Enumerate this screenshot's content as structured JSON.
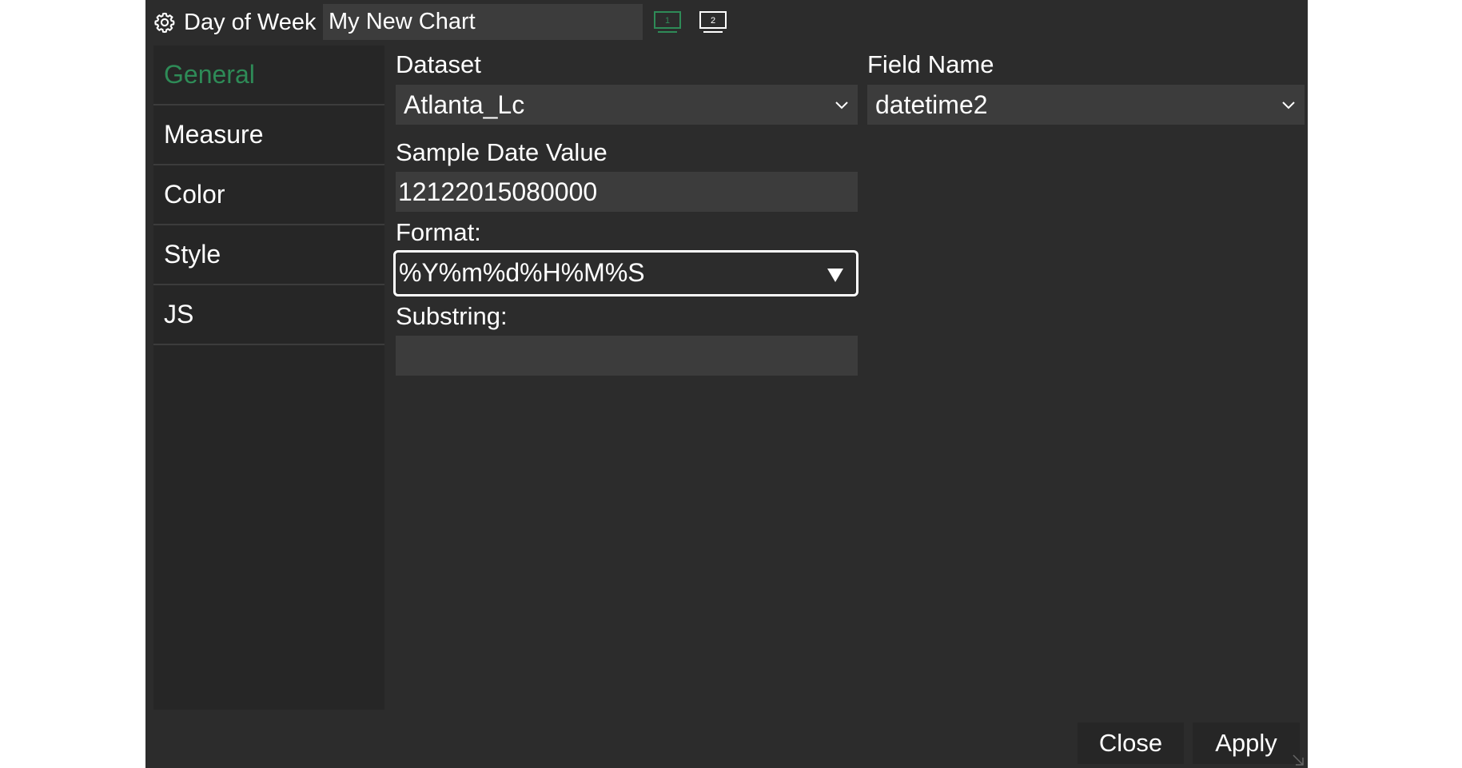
{
  "titlebar": {
    "icon": "gear-icon",
    "title": "Day of Week",
    "chart_name": "My New Chart",
    "monitor1_label": "1",
    "monitor2_label": "2"
  },
  "sidebar": {
    "items": [
      {
        "label": "General",
        "active": true
      },
      {
        "label": "Measure"
      },
      {
        "label": "Color"
      },
      {
        "label": "Style"
      },
      {
        "label": "JS"
      }
    ]
  },
  "form": {
    "dataset_label": "Dataset",
    "dataset_value": "Atlanta_Lc",
    "field_name_label": "Field Name",
    "field_name_value": "datetime2",
    "sample_date_label": "Sample Date Value",
    "sample_date_value": "12122015080000",
    "format_label": "Format:",
    "format_value": "%Y%m%d%H%M%S",
    "substring_label": "Substring:",
    "substring_value": ""
  },
  "buttons": {
    "close": "Close",
    "apply": "Apply"
  },
  "colors": {
    "background": "#2c2c2c",
    "sidebar": "#262626",
    "input": "#3c3c3c",
    "accent": "#2e8b57"
  }
}
